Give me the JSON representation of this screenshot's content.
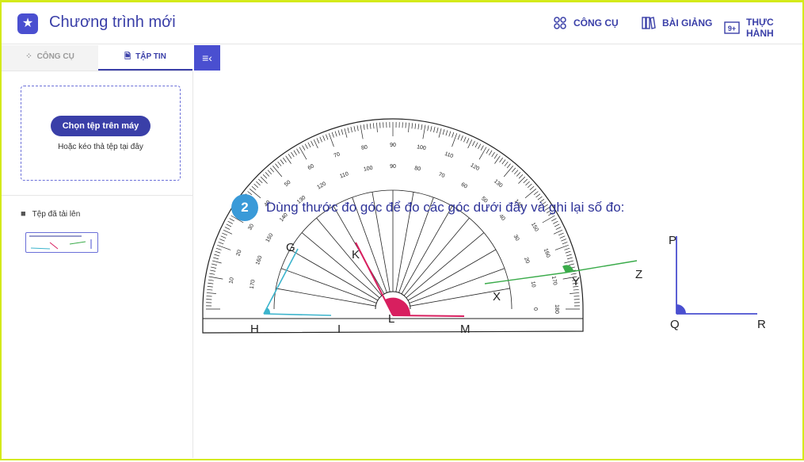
{
  "app": {
    "title": "Chương trình mới"
  },
  "nav": [
    {
      "label": "CÔNG CỤ",
      "icon": "tools-grid-icon"
    },
    {
      "label": "BÀI GIẢNG",
      "icon": "books-icon"
    },
    {
      "label": "THỰC HÀNH",
      "icon": "practice-9plus-icon"
    }
  ],
  "tabs": [
    {
      "label": "CÔNG CỤ",
      "active": false
    },
    {
      "label": "TẬP TIN",
      "active": true
    }
  ],
  "sidebar": {
    "upload_button": "Chọn tệp trên máy",
    "drop_hint": "Hoặc kéo thả tệp tại đây",
    "uploaded_label": "Tệp đã tải lên"
  },
  "canvas": {
    "question_number": "2",
    "question_text": "Dùng thước đo góc để đo các góc dưới đây và ghi lại số đo:",
    "outer_scale": [
      "10",
      "20",
      "30",
      "40",
      "50",
      "60",
      "70",
      "80",
      "90",
      "100",
      "110",
      "120",
      "130",
      "140",
      "150",
      "160",
      "170",
      "180"
    ],
    "inner_scale": [
      "170",
      "160",
      "150",
      "140",
      "130",
      "120",
      "110",
      "100",
      "90",
      "80",
      "70",
      "60",
      "50",
      "40",
      "30",
      "20",
      "10",
      "0"
    ],
    "point_labels": [
      "G",
      "H",
      "I",
      "K",
      "L",
      "M",
      "X",
      "Y",
      "Z",
      "P",
      "Q",
      "R"
    ]
  },
  "colors": {
    "accent": "#3a3fa8",
    "frame": "#d4ea1a",
    "red": "#d81f5f",
    "cyan": "#3cb4cc",
    "green": "#3aab4a",
    "blue": "#4a4fd0"
  }
}
